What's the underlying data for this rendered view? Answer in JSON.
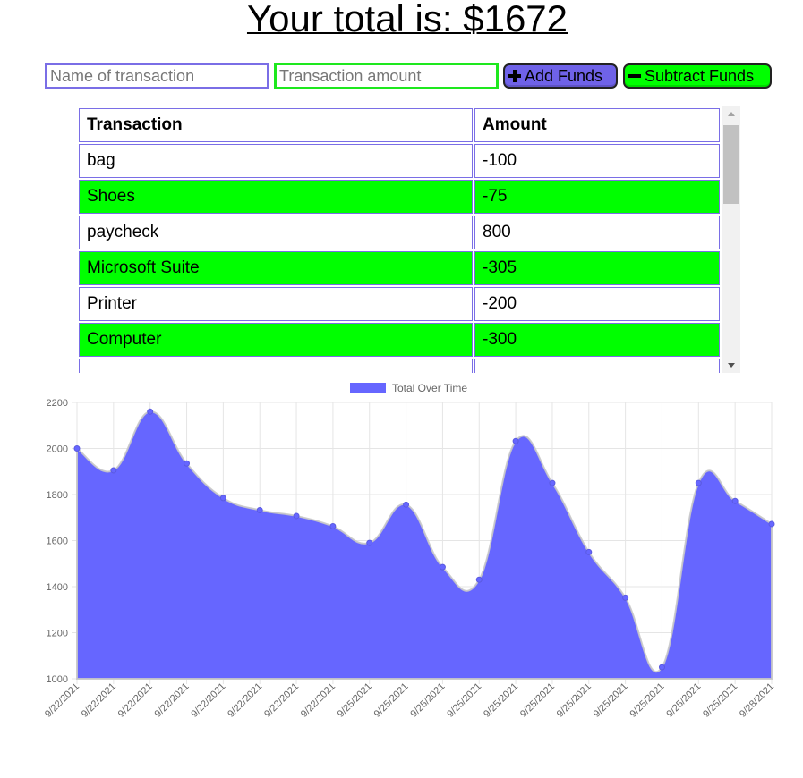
{
  "header": {
    "title": "Your total is: $1672"
  },
  "form": {
    "name_placeholder": "Name of transaction",
    "amount_placeholder": "Transaction amount",
    "add_label": "Add Funds",
    "subtract_label": "Subtract Funds",
    "add_color": "#6f62e8",
    "subtract_color": "#00ff00"
  },
  "table": {
    "headers": [
      "Transaction",
      "Amount"
    ],
    "rows": [
      {
        "name": "bag",
        "amount": "-100"
      },
      {
        "name": "Shoes",
        "amount": "-75"
      },
      {
        "name": "paycheck",
        "amount": "800"
      },
      {
        "name": "Microsoft Suite",
        "amount": "-305"
      },
      {
        "name": "Printer",
        "amount": "-200"
      },
      {
        "name": "Computer",
        "amount": "-300"
      }
    ]
  },
  "chart_data": {
    "type": "area",
    "legend": "Total Over Time",
    "legend_position": "top",
    "grid": true,
    "fill_color": "#6666ff",
    "ylim": [
      1000,
      2200
    ],
    "y_ticks": [
      1000,
      1200,
      1400,
      1600,
      1800,
      2000,
      2200
    ],
    "categories": [
      "9/22/2021",
      "9/22/2021",
      "9/22/2021",
      "9/22/2021",
      "9/22/2021",
      "9/22/2021",
      "9/22/2021",
      "9/22/2021",
      "9/25/2021",
      "9/25/2021",
      "9/25/2021",
      "9/25/2021",
      "9/25/2021",
      "9/25/2021",
      "9/25/2021",
      "9/25/2021",
      "9/25/2021",
      "9/25/2021",
      "9/25/2021",
      "9/28/2021"
    ],
    "series": [
      {
        "name": "Total Over Time",
        "values": [
          2000,
          1905,
          2160,
          1935,
          1785,
          1732,
          1707,
          1662,
          1590,
          1756,
          1485,
          1430,
          2032,
          1850,
          1550,
          1352,
          1050,
          1850,
          1772,
          1672
        ]
      }
    ]
  }
}
